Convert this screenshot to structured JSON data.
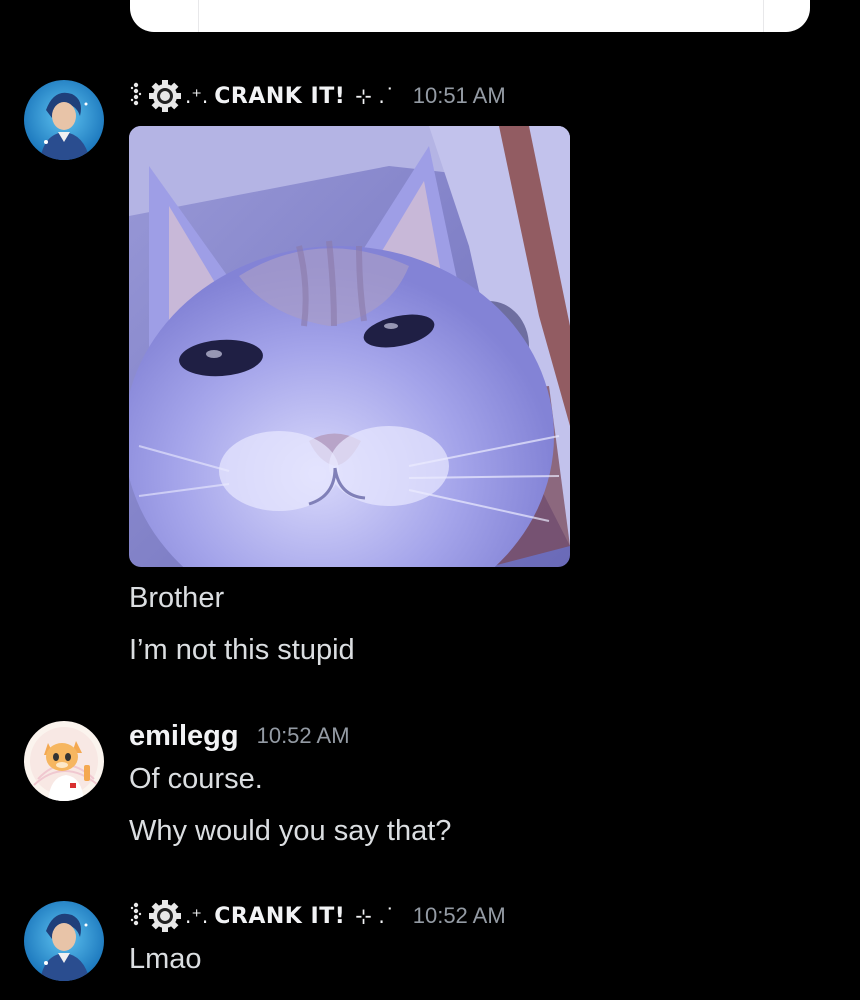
{
  "messages": [
    {
      "author": "CRANK IT!",
      "timestamp": "10:51 AM",
      "attachment": "cat-image",
      "lines": [
        "Brother",
        "I’m not this stupid"
      ]
    },
    {
      "author": "emilegg",
      "timestamp": "10:52 AM",
      "lines": [
        "Of course.",
        "Why would you say that?"
      ]
    },
    {
      "author": "CRANK IT!",
      "timestamp": "10:52 AM",
      "lines": [
        "Lmao"
      ]
    }
  ],
  "colors": {
    "background": "#000000",
    "username": "#f2f3f5",
    "message_text": "#dbdee1",
    "timestamp": "#949ba4",
    "image_tint": "#8f8fe0"
  }
}
